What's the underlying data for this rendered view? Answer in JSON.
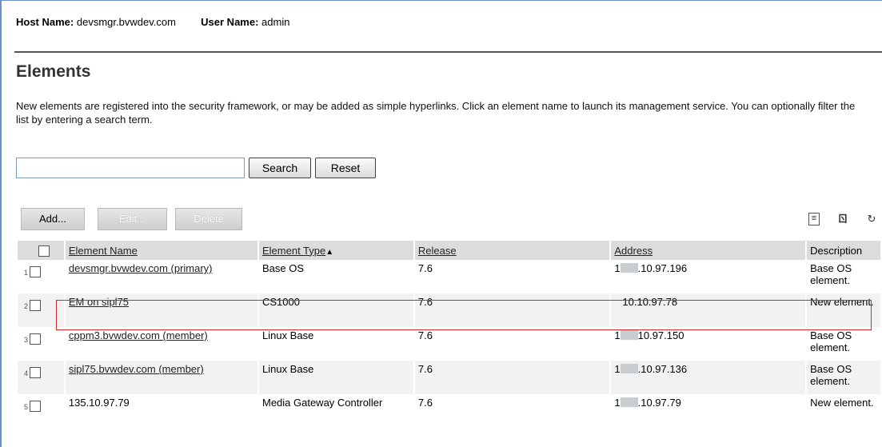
{
  "host": {
    "host_label": "Host Name:",
    "host_value": "devsmgr.bvwdev.com",
    "user_label": "User Name:",
    "user_value": "admin"
  },
  "page": {
    "title": "Elements",
    "description": "New elements are registered into the security framework, or may be added as simple hyperlinks. Click an element name to launch its management service. You can optionally filter the list by entering a search term."
  },
  "search": {
    "value": "",
    "placeholder": "",
    "search_label": "Search",
    "reset_label": "Reset"
  },
  "toolbar": {
    "add_label": "Add...",
    "edit_label": "Edit...",
    "delete_label": "Delete",
    "icons": [
      "list-view-icon",
      "columns-icon",
      "refresh-icon"
    ]
  },
  "table": {
    "columns": [
      "Element Name",
      "Element Type",
      "Release",
      "Address",
      "Description"
    ],
    "sorted_column": "Element Type",
    "sort_direction": "ascending",
    "rows": [
      {
        "index": "1",
        "name": "devsmgr.bvwdev.com (primary)",
        "type": "Base OS",
        "release": "7.6",
        "address": ".10.97.196",
        "address_prefix": "1",
        "description": "Base OS element."
      },
      {
        "index": "2",
        "name": "EM on sipl75",
        "type": "CS1000",
        "release": "7.6",
        "address": "10.10.97.78",
        "address_prefix": "",
        "description": "New element."
      },
      {
        "index": "3",
        "name": "cppm3.bvwdev.com (member)",
        "type": "Linux Base",
        "release": "7.6",
        "address": "10.97.150",
        "address_prefix": "1",
        "description": "Base OS element."
      },
      {
        "index": "4",
        "name": "sipl75.bvwdev.com (member)",
        "type": "Linux Base",
        "release": "7.6",
        "address": ".10.97.136",
        "address_prefix": "1",
        "description": "Base OS element."
      },
      {
        "index": "5",
        "name": "135.10.97.79",
        "type": "Media Gateway Controller",
        "release": "7.6",
        "address": ".10.97.79",
        "address_prefix": "1",
        "description": "New element."
      }
    ]
  },
  "highlight_color": "#d12b2b"
}
